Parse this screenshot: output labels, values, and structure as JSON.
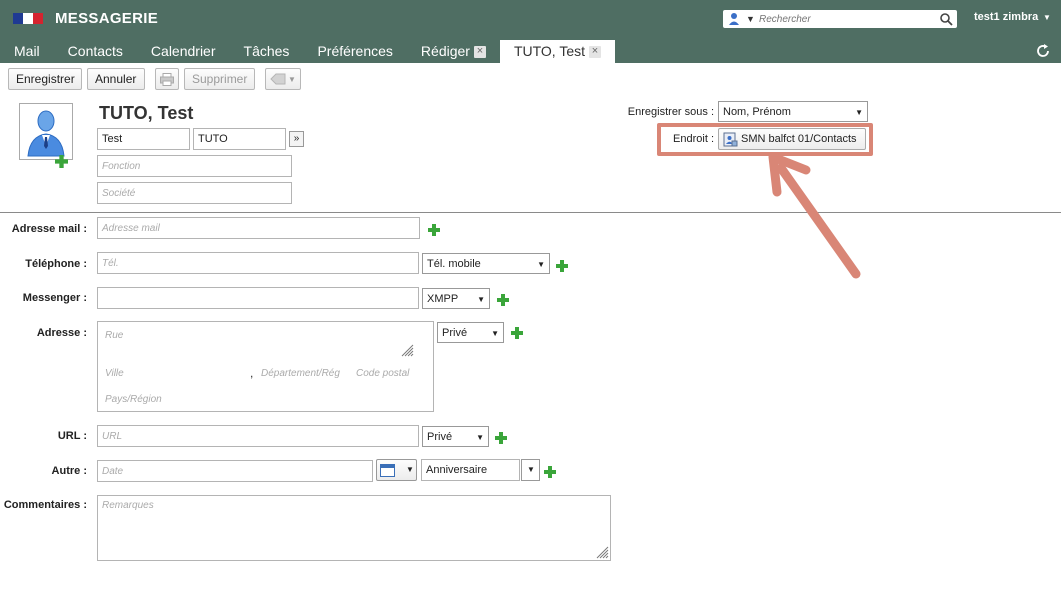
{
  "header": {
    "title": "MESSAGERIE",
    "search_placeholder": "Rechercher",
    "user": "test1 zimbra"
  },
  "tabs": [
    {
      "label": "Mail",
      "closable": false,
      "active": false
    },
    {
      "label": "Contacts",
      "closable": false,
      "active": false
    },
    {
      "label": "Calendrier",
      "closable": false,
      "active": false
    },
    {
      "label": "Tâches",
      "closable": false,
      "active": false
    },
    {
      "label": "Préférences",
      "closable": false,
      "active": false
    },
    {
      "label": "Rédiger",
      "closable": true,
      "active": false
    },
    {
      "label": "TUTO, Test",
      "closable": true,
      "active": true
    }
  ],
  "toolbar": {
    "save": "Enregistrer",
    "cancel": "Annuler",
    "delete": "Supprimer"
  },
  "contact": {
    "display_name": "TUTO, Test",
    "first_name": "Test",
    "last_name": "TUTO",
    "more": "»",
    "job_placeholder": "Fonction",
    "company_placeholder": "Société",
    "save_as_label": "Enregistrer sous :",
    "save_as_value": "Nom, Prénom",
    "location_label": "Endroit :",
    "location_value": "SMN balfct 01/Contacts"
  },
  "form": {
    "email_label": "Adresse mail :",
    "email_placeholder": "Adresse mail",
    "phone_label": "Téléphone :",
    "phone_placeholder": "Tél.",
    "phone_type": "Tél. mobile",
    "messenger_label": "Messenger :",
    "messenger_type": "XMPP",
    "address_label": "Adresse :",
    "address_type": "Privé",
    "street_placeholder": "Rue",
    "city_placeholder": "Ville",
    "comma": ",",
    "region_placeholder": "Département/Rég",
    "zip_placeholder": "Code postal",
    "country_placeholder": "Pays/Région",
    "url_label": "URL :",
    "url_placeholder": "URL",
    "url_type": "Privé",
    "other_label": "Autre :",
    "date_placeholder": "Date",
    "other_type": "Anniversaire",
    "comments_label": "Commentaires :",
    "comments_placeholder": "Remarques"
  },
  "colors": {
    "header_bg": "#4f6e63",
    "annotation": "#d98676",
    "plus_green": "#3aa53a"
  }
}
